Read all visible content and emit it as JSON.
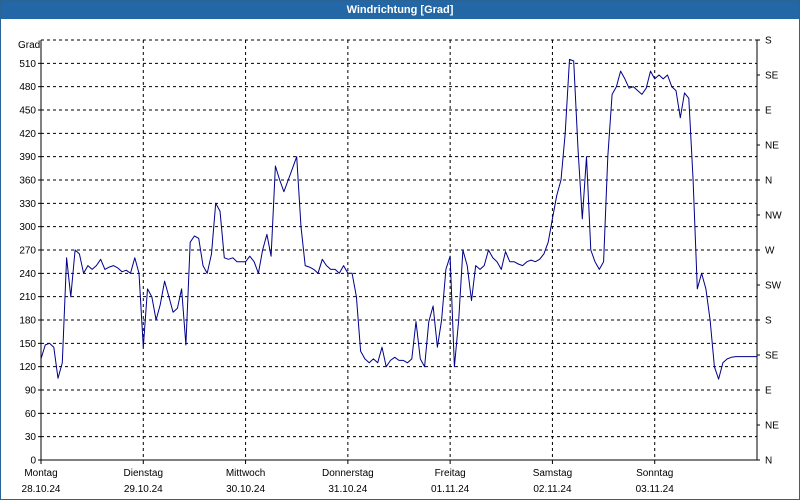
{
  "window": {
    "title": "Windrichtung [Grad]"
  },
  "chart_data": {
    "type": "line",
    "title": "Windrichtung [Grad]",
    "ylabel": "Grad",
    "ylim": [
      0,
      540
    ],
    "yticks": [
      0,
      30,
      60,
      90,
      120,
      150,
      180,
      210,
      240,
      270,
      300,
      330,
      360,
      390,
      420,
      450,
      480,
      510
    ],
    "y2_tick_labels": [
      "N",
      "NE",
      "E",
      "SE",
      "S",
      "SW",
      "W",
      "NW",
      "N",
      "NE",
      "E",
      "SE",
      "S"
    ],
    "x_days": [
      {
        "day": "Montag",
        "date": "28.10.24"
      },
      {
        "day": "Dienstag",
        "date": "29.10.24"
      },
      {
        "day": "Mittwoch",
        "date": "30.10.24"
      },
      {
        "day": "Donnerstag",
        "date": "31.10.24"
      },
      {
        "day": "Freitag",
        "date": "01.11.24"
      },
      {
        "day": "Samstag",
        "date": "02.11.24"
      },
      {
        "day": "Sonntag",
        "date": "03.11.24"
      }
    ],
    "x_unit": "hours since 28.10.24 00:00",
    "xlim": [
      0,
      168
    ],
    "grid": true,
    "line_color": "#00008b",
    "series": [
      {
        "x": [
          0,
          1,
          2,
          3,
          4,
          5,
          6,
          7,
          8,
          9,
          10,
          11,
          12,
          13,
          14,
          15,
          16,
          17,
          18,
          19,
          20,
          21,
          22,
          23,
          24,
          25,
          26,
          27,
          28,
          29,
          30,
          31,
          32,
          33,
          34,
          35,
          36,
          37,
          38,
          39,
          40,
          41,
          42,
          43,
          44,
          45,
          46,
          47,
          48,
          49,
          50,
          51,
          52,
          53,
          54,
          55,
          56,
          57,
          58,
          59,
          60,
          61,
          62,
          63,
          64,
          65,
          66,
          67,
          68,
          69,
          70,
          71,
          72,
          73,
          74,
          75,
          76,
          77,
          78,
          79,
          80,
          81,
          82,
          83,
          84,
          85,
          86,
          87,
          88,
          89,
          90,
          91,
          92,
          93,
          94,
          95,
          96,
          97,
          98,
          99,
          100,
          101,
          102,
          103,
          104,
          105,
          106,
          107,
          108,
          109,
          110,
          111,
          112,
          113,
          114,
          115,
          116,
          117,
          118,
          119,
          120,
          121,
          122,
          123,
          124,
          125,
          126,
          127,
          128,
          129,
          130,
          131,
          132,
          133,
          134,
          135,
          136,
          137,
          138,
          139,
          140,
          141,
          142,
          143,
          144,
          145,
          146,
          147,
          148,
          149,
          150,
          151,
          152,
          153,
          154,
          155,
          156,
          157,
          158,
          159,
          160,
          161,
          162,
          163,
          164,
          165,
          166,
          167,
          168
        ],
        "y": [
          130,
          148,
          150,
          145,
          105,
          125,
          260,
          210,
          270,
          265,
          240,
          250,
          245,
          250,
          258,
          245,
          248,
          250,
          247,
          242,
          244,
          240,
          260,
          240,
          145,
          220,
          210,
          180,
          200,
          230,
          210,
          190,
          195,
          220,
          148,
          280,
          288,
          285,
          250,
          240,
          265,
          330,
          320,
          260,
          258,
          260,
          255,
          255,
          255,
          262,
          255,
          240,
          270,
          290,
          262,
          378,
          360,
          345,
          360,
          375,
          390,
          300,
          250,
          248,
          245,
          240,
          258,
          250,
          245,
          245,
          240,
          250,
          240,
          240,
          210,
          140,
          130,
          125,
          130,
          125,
          145,
          120,
          128,
          132,
          128,
          128,
          125,
          130,
          178,
          130,
          120,
          178,
          198,
          145,
          180,
          245,
          262,
          120,
          180,
          270,
          250,
          205,
          250,
          245,
          250,
          270,
          260,
          255,
          245,
          268,
          255,
          255,
          252,
          250,
          255,
          257,
          255,
          258,
          265,
          280,
          310,
          340,
          360,
          420,
          515,
          513,
          400,
          310,
          390,
          270,
          255,
          245,
          255,
          390,
          470,
          480,
          500,
          490,
          478,
          480,
          475,
          470,
          478,
          500,
          490,
          495,
          490,
          495,
          480,
          475,
          440,
          472,
          465,
          360,
          220,
          240,
          220,
          180,
          120,
          104,
          125,
          130,
          132,
          133,
          133,
          133,
          133,
          133,
          133
        ]
      }
    ]
  }
}
